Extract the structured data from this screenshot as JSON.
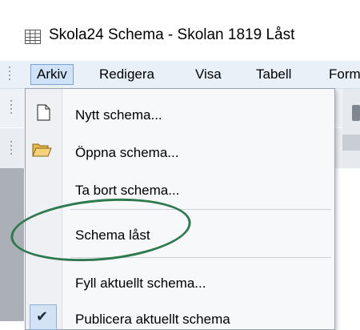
{
  "window": {
    "title": "Skola24 Schema - Skolan 1819  Låst",
    "icon": "grid-app-icon"
  },
  "menubar": {
    "items": [
      {
        "label": "Arkiv",
        "active": true
      },
      {
        "label": "Redigera"
      },
      {
        "label": "Visa"
      },
      {
        "label": "Tabell"
      },
      {
        "label": "Form"
      }
    ]
  },
  "file_menu": {
    "items": [
      {
        "label": "Nytt schema...",
        "icon": "new-document-icon"
      },
      {
        "label": "Öppna schema...",
        "icon": "open-folder-icon"
      },
      {
        "label": "Ta bort schema..."
      },
      {
        "label": "Schema låst",
        "checked": true,
        "icon": "checkmark-icon"
      },
      {
        "label": "Fyll aktuellt schema..."
      },
      {
        "label": "Publicera aktuellt schema"
      }
    ]
  },
  "annotation": {
    "color": "#2e7a4e",
    "shape": "ellipse"
  }
}
